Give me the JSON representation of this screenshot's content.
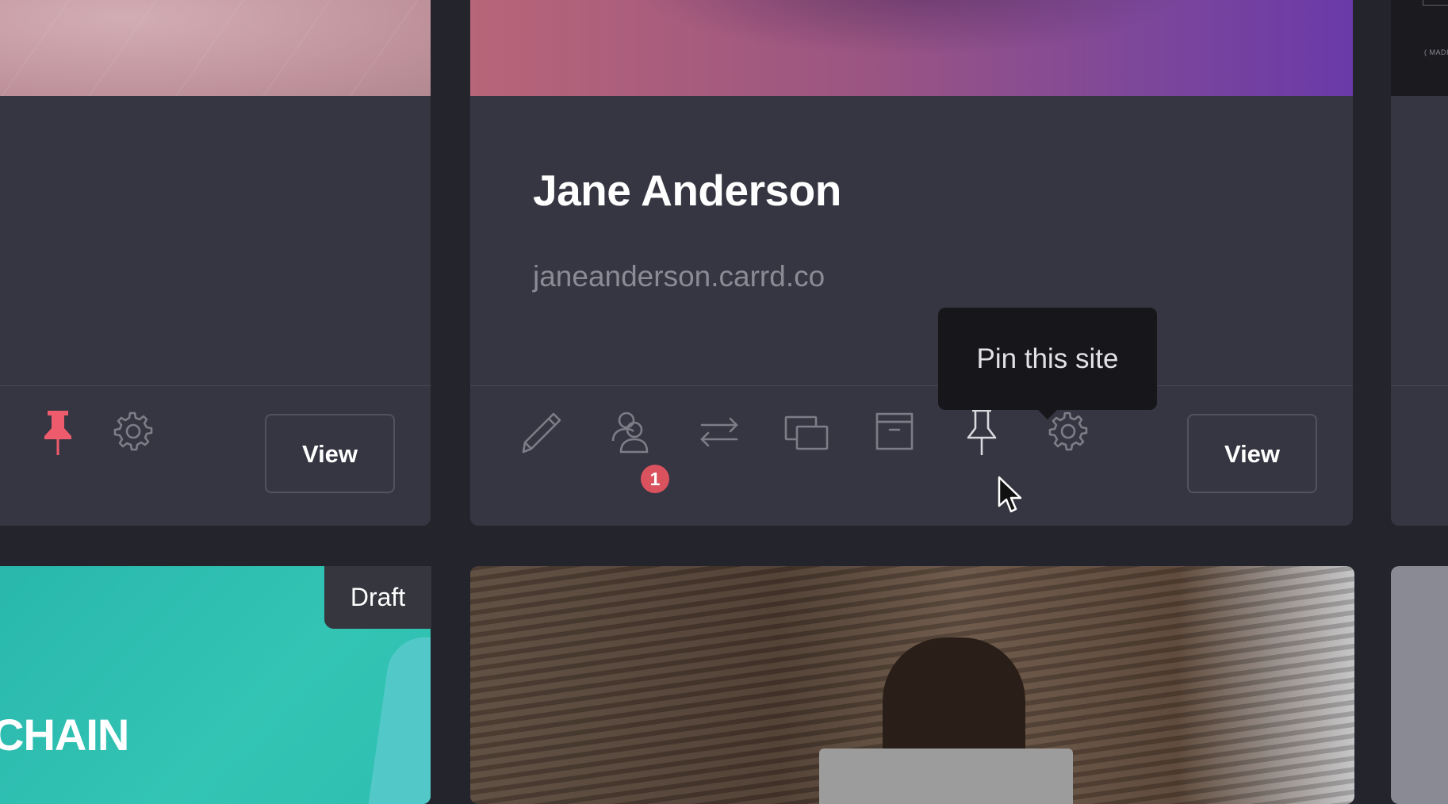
{
  "cards": {
    "left": {
      "pin_icon": "pin-filled-icon",
      "settings_icon": "gear-icon",
      "view_label": "View",
      "pin_color": "#ee5b6d"
    },
    "main": {
      "title": "Jane Anderson",
      "url": "janeanderson.carrd.co",
      "toolbar": {
        "edit_icon": "pencil-icon",
        "collaborators_icon": "users-icon",
        "collaborators_badge": "1",
        "transfer_icon": "transfer-arrows-icon",
        "duplicate_icon": "duplicate-icon",
        "archive_icon": "archive-icon",
        "pin_icon": "pin-outline-icon",
        "settings_icon": "gear-icon",
        "view_label": "View"
      },
      "tooltip": "Pin this site"
    },
    "right": {
      "thumb_text": "( MADI"
    },
    "bottom_left": {
      "status": "Draft",
      "thumb_text": "CHAIN"
    }
  },
  "colors": {
    "background": "#24242d",
    "card": "#363642",
    "badge": "#d9525e",
    "tooltip": "#17171b",
    "teal": "#2fbfb0"
  }
}
